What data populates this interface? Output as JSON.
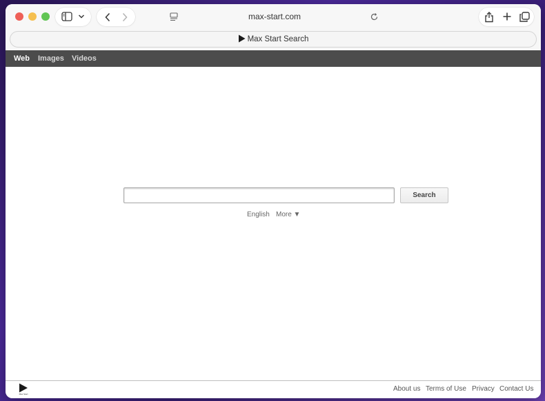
{
  "browser": {
    "url": "max-start.com",
    "tab_title": "Max Start Search"
  },
  "nav": {
    "items": [
      {
        "label": "Web",
        "active": true
      },
      {
        "label": "Images",
        "active": false
      },
      {
        "label": "Videos",
        "active": false
      }
    ]
  },
  "search": {
    "input_value": "",
    "button_label": "Search"
  },
  "language": {
    "current": "English",
    "more_label": "More ▼"
  },
  "footer": {
    "logo_text": "Max Start",
    "links": [
      "About us",
      "Terms of Use",
      "Privacy",
      "Contact Us"
    ]
  },
  "colors": {
    "navbar_bg": "#4c4c4c",
    "close": "#ee5f57",
    "minimize": "#f5bf4f",
    "zoom": "#61c554"
  }
}
